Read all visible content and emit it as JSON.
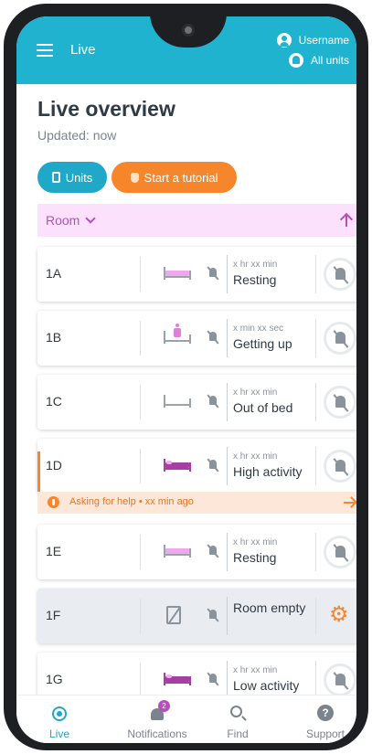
{
  "appbar": {
    "title": "Live",
    "username": "Username",
    "units_filter": "All units"
  },
  "page": {
    "heading": "Live overview",
    "updated": "Updated: now"
  },
  "actions": {
    "units_label": "Units",
    "tutorial_label": "Start a tutorial"
  },
  "sort": {
    "label": "Room",
    "direction": "ascending"
  },
  "rooms": [
    {
      "room": "1A",
      "time": "x hr xx min",
      "status": "Resting",
      "bed_icon": "bed-icon"
    },
    {
      "room": "1B",
      "time": "x min xx sec",
      "status": "Getting up",
      "bed_icon": "bed-person-icon"
    },
    {
      "room": "1C",
      "time": "x hr xx min",
      "status": "Out of bed",
      "bed_icon": "empty-bed-icon"
    },
    {
      "room": "1D",
      "time": "x hr xx min",
      "status": "High activity",
      "bed_icon": "bed-active-icon",
      "alert": "Asking for help • xx min ago"
    },
    {
      "room": "1E",
      "time": "x hr xx min",
      "status": "Resting",
      "bed_icon": "bed-icon"
    },
    {
      "room": "1F",
      "status": "Room empty",
      "bed_icon": "room-empty-door-icon"
    },
    {
      "room": "1G",
      "time": "x hr xx min",
      "status": "Low activity",
      "bed_icon": "bed-active-icon"
    }
  ],
  "nav": {
    "live": "Live",
    "notifications": "Notifications",
    "notifications_badge": "2",
    "find": "Find",
    "support": "Support",
    "support_glyph": "?"
  },
  "colors": {
    "primary": "#20b3cf",
    "accent_orange": "#f6862b",
    "sort_bar": "#fbe1fb",
    "sort_text": "#b64fbd",
    "bed_resting": "#f0a8ec",
    "bed_active": "#a53fa4",
    "empty_room_card": "#e9edf2"
  }
}
